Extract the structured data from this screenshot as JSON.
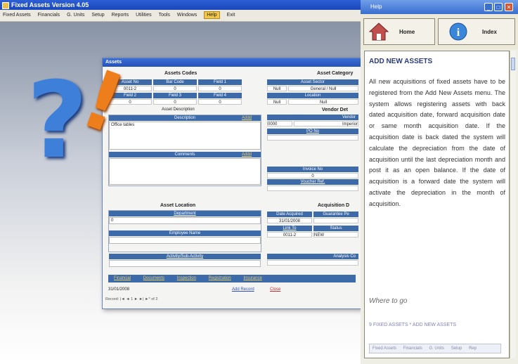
{
  "app": {
    "title": "Fixed Assets Version 4.05",
    "menu": [
      "Fixed Assets",
      "Financials",
      "G. Units",
      "Setup",
      "Reports",
      "Utilities",
      "Tools",
      "Windows",
      "Help",
      "Exit"
    ],
    "active_menu": "Help"
  },
  "assets_window": {
    "title": "Assets",
    "codes": {
      "section": "Assets Codes",
      "headers1": [
        "Asset No",
        "Bar Code",
        "Field 1"
      ],
      "values1": [
        "0011-2",
        "0",
        "0"
      ],
      "headers2": [
        "Field 2",
        "Field 3",
        "Field 4"
      ],
      "values2": [
        "0",
        "0",
        "0"
      ]
    },
    "category": {
      "section": "Asset Category",
      "headers1": [
        "Asset Sector",
        ""
      ],
      "values1": [
        "Null",
        "General / Null"
      ],
      "headers2": [
        "Location",
        ""
      ],
      "values2": [
        "Null",
        "Null"
      ]
    },
    "description": {
      "label": "Asset Description",
      "desc_header": "Description",
      "desc_action": "Addd",
      "desc_value": "Office tables",
      "comments_header": "Comments",
      "comments_action": "Addd"
    },
    "vendor": {
      "section": "Vendor Det",
      "vendor_header": "Vendor",
      "vendor_code": "0000",
      "vendor_name": "Imperior",
      "lpo_label": "PO No",
      "invoice_header": "Invoice No",
      "invoice_value": "0",
      "voucher_label": "Voucher Ref."
    },
    "location": {
      "section": "Asset Location",
      "department_header": "Department",
      "department_value": "0",
      "employee_header": "Employee Name",
      "activity_header": "Activity/Sub-Activity"
    },
    "acquisition": {
      "section": "Acquisition D",
      "date_header": "Date Acquired",
      "guarantee_header": "Guarantee Pe",
      "date_value": "31/01/2008",
      "link_header": "Link To",
      "status_header": "Status",
      "link_value": "0011-2",
      "status_value": "NEW",
      "analysis_header": "Analysis Co"
    },
    "tabs": [
      "Financial",
      "Documents",
      "Inspection",
      "Registration",
      "Insurance"
    ],
    "footer": {
      "date": "31/01/2008",
      "add_record": "Add Record",
      "close": "Close",
      "record_nav": "Record: |◄ ◄ 1 ► ►| ►* of 2"
    }
  },
  "help": {
    "title": "Help",
    "home_label": "Home",
    "index_label": "Index",
    "heading": "ADD NEW ASSETS",
    "body": "All new acquisitions of fixed assets have to be registered from the Add New Assets menu. The system allows registering assets with back dated acquisition date, forward acquisition date or same month acquisition date. If the acquisition date is back dated the system will calculate the depreciation from the date of acquisition until the last depreciation month and post it as an open balance. If the date of acquisition is a forward date the system will activate the depreciation in the month of acquisition.",
    "where_to_go": "Where to go",
    "path": "9 FIXED ASSETS * ADD NEW ASSETS",
    "mini_tabs": [
      "Fixed Assets",
      "Financials",
      "G. Units",
      "Setup",
      "Rep"
    ]
  },
  "colors": {
    "accent_blue": "#3d6aa8",
    "question_mark": "#3d7fd9",
    "exclamation": "#ee7d1b",
    "title_bar": "#2d5fd6"
  },
  "icons": [
    "home-icon",
    "info-icon",
    "question-mark-icon",
    "exclamation-mark-icon"
  ]
}
